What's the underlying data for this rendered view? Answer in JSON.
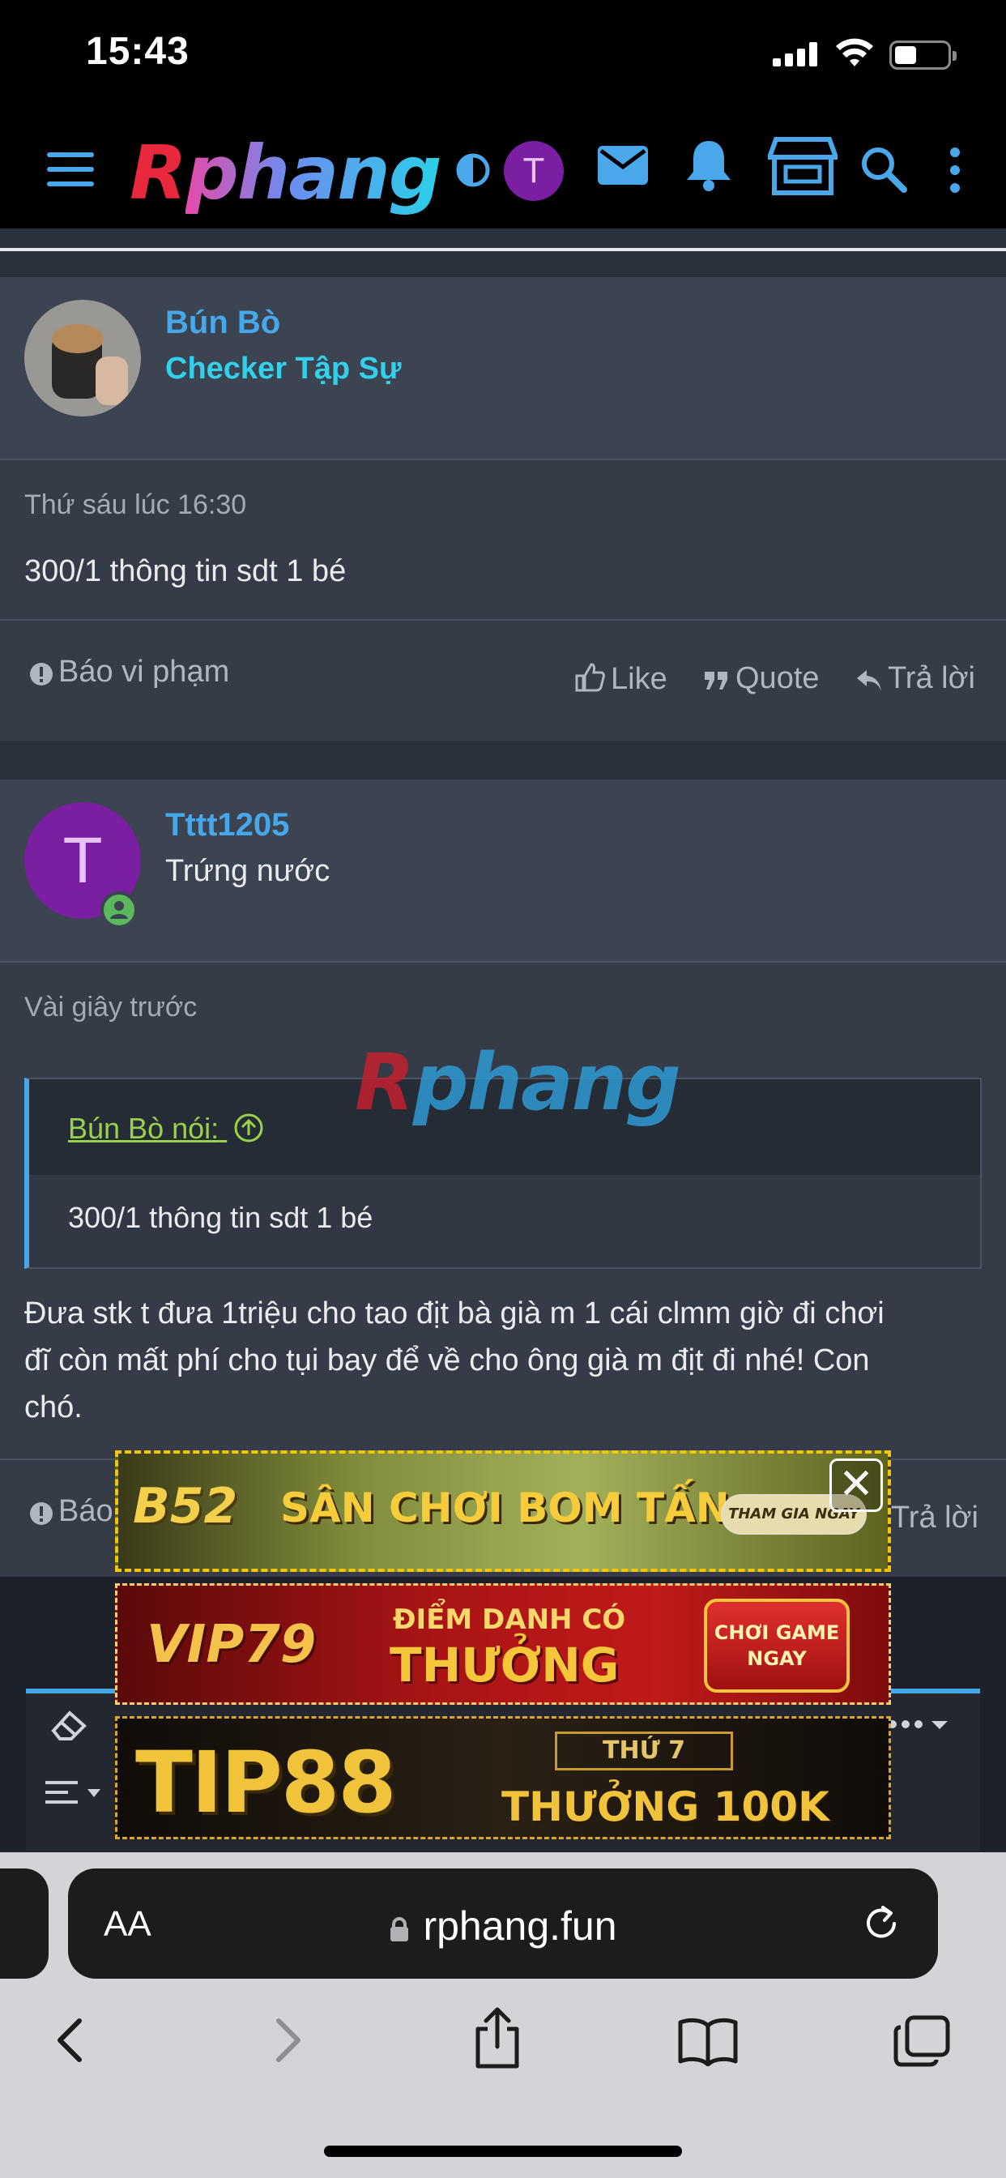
{
  "status_bar": {
    "time": "15:43"
  },
  "header": {
    "logo_r": "R",
    "logo_rest": "phang",
    "avatar_letter": "T"
  },
  "post1": {
    "username": "Bún Bò",
    "user_title": "Checker Tập Sự",
    "time": "Thứ sáu lúc 16:30",
    "body": "300/1 thông tin sdt 1 bé",
    "report": "Báo vi phạm",
    "like": "Like",
    "quote": "Quote",
    "reply": "Trả lời"
  },
  "post2": {
    "avatar_letter": "T",
    "username": "Tttt1205",
    "user_title": "Trứng nước",
    "time": "Vài giây trước",
    "quote_by": "Bún Bò nói:",
    "quote_body": "300/1 thông tin sdt 1 bé",
    "body_line1": "Đưa stk t đưa 1triệu cho tao địt bà già m 1 cái clmm giờ đi chơi",
    "body_line2": "đĩ còn mất phí cho tụi bay để về cho ông già m địt đi nhé! Con",
    "body_line3": "chó.",
    "report_partial": "Báo",
    "reply": "Trả lời"
  },
  "watermark": {
    "r": "R",
    "rest": "phang"
  },
  "ads": {
    "ad1_brand": "B52",
    "ad1_text": "SÂN CHƠI BOM TẤN",
    "ad1_button": "THAM GIA NGAY",
    "ad2_brand": "VIP79",
    "ad2_line1": "ĐIỂM DANH CÓ",
    "ad2_line2": "THƯỞNG",
    "ad2_button_line1": "CHƠI GAME",
    "ad2_button_line2": "NGAY",
    "ad3_brand": "TIP88",
    "ad3_day": "THỨ 7",
    "ad3_text": "THƯỞNG 100K",
    "close": "✕"
  },
  "safari": {
    "aa": "AA",
    "url": "rphang.fun"
  },
  "colors": {
    "accent_blue": "#47a7eb",
    "user_title_cyan": "#33d0ec",
    "online_green": "#5cb85c",
    "avatar_purple": "#7a1fa2"
  }
}
